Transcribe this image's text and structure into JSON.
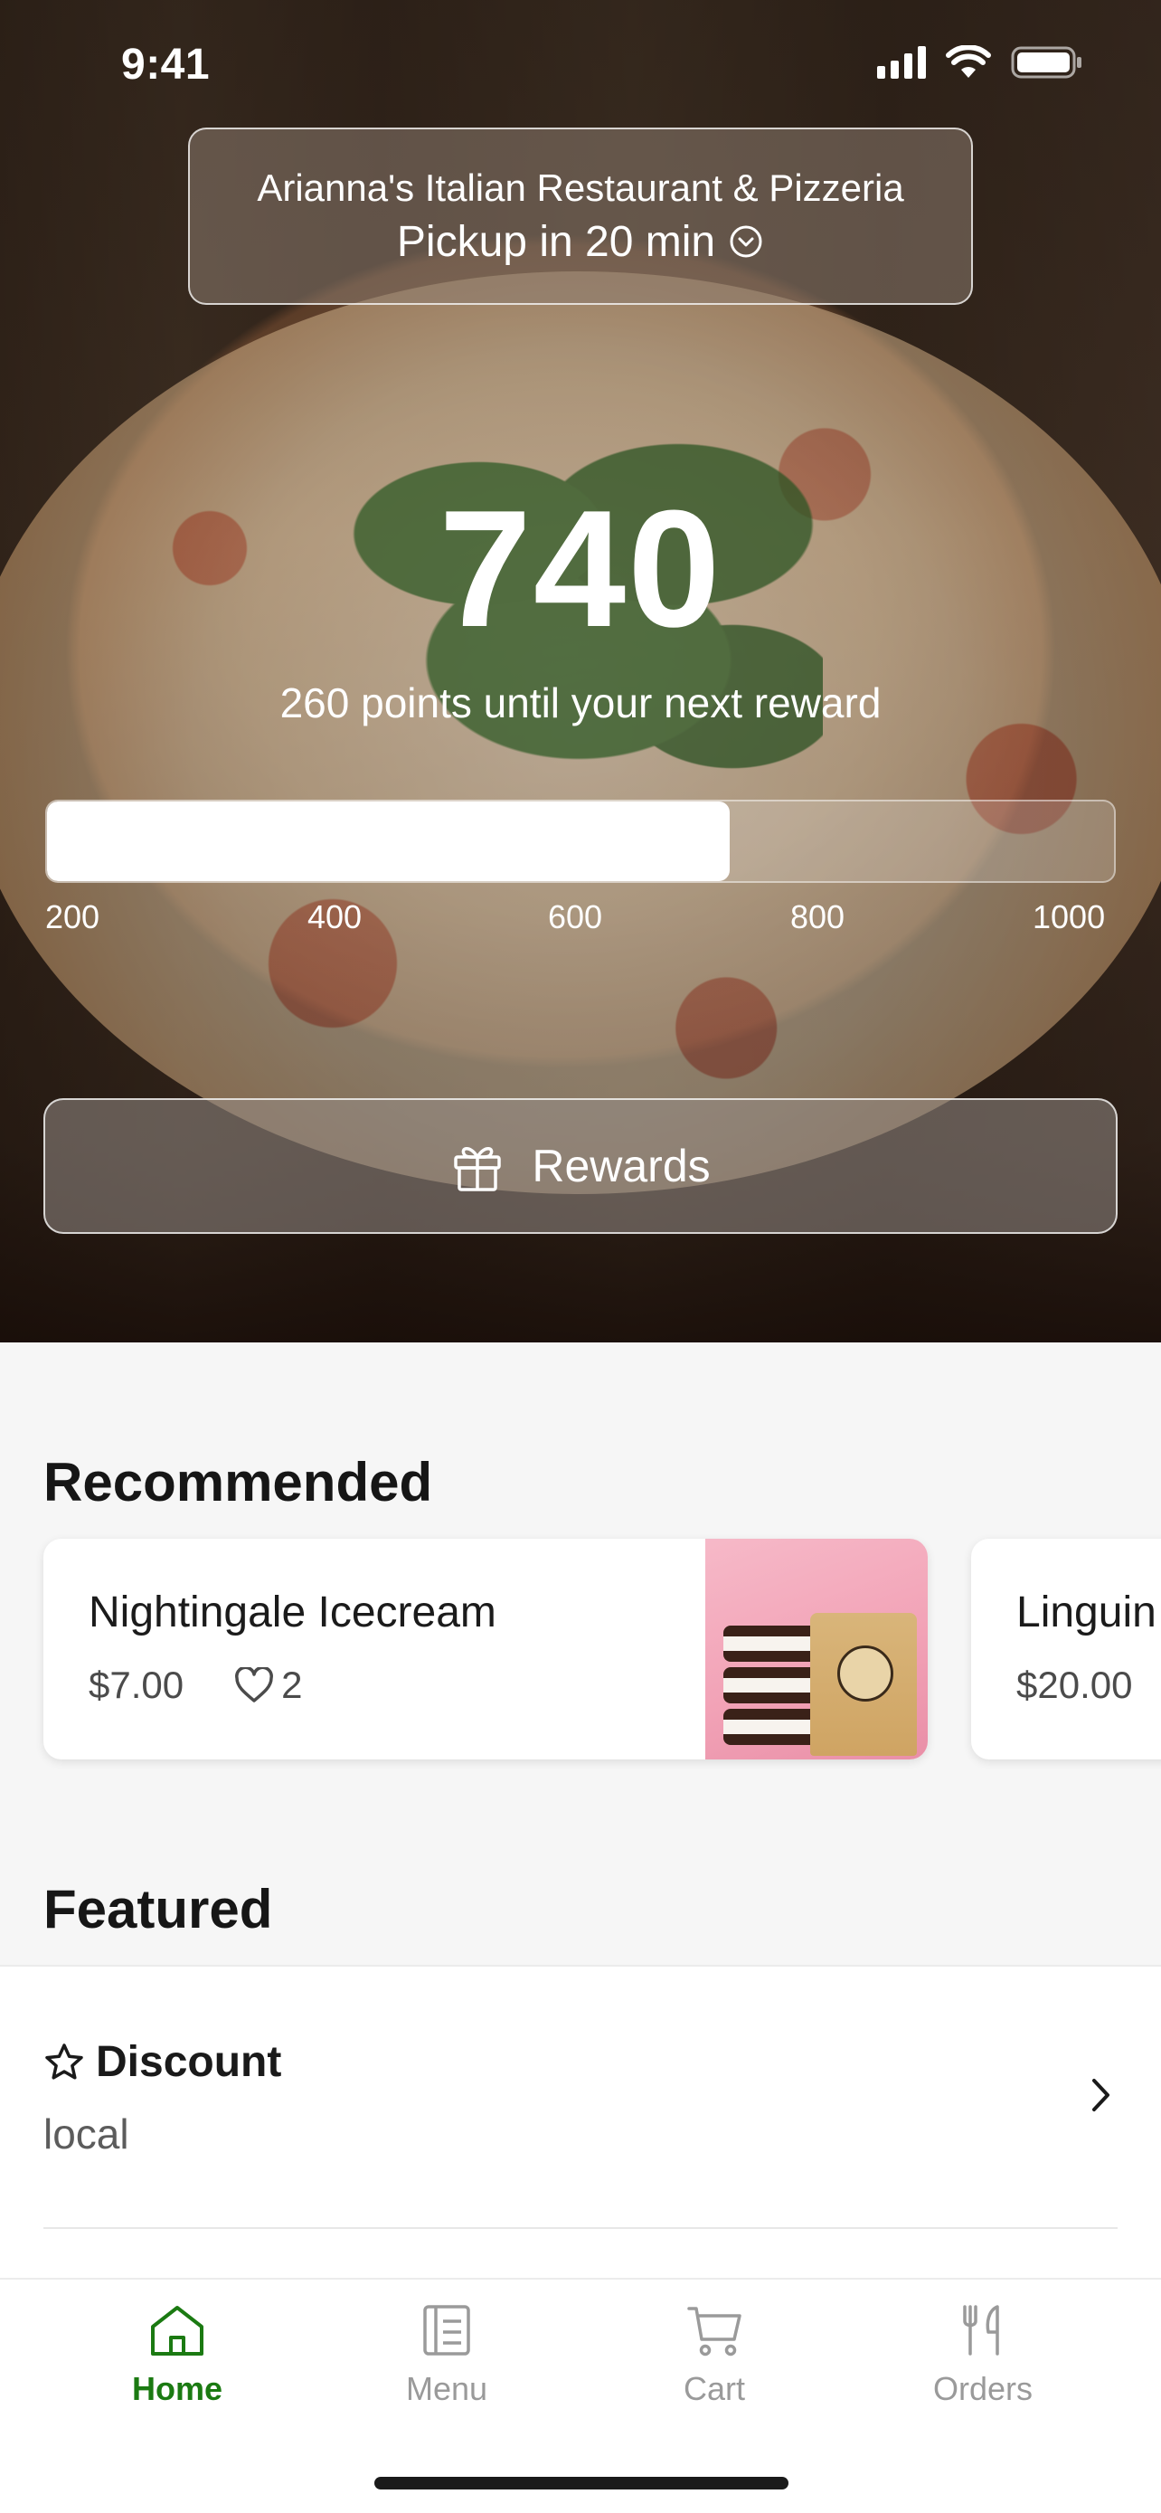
{
  "status_bar": {
    "time": "9:41"
  },
  "store": {
    "name": "Arianna's Italian Restaurant & Pizzeria",
    "pickup": "Pickup in 20 min"
  },
  "points": {
    "value": "740",
    "subtitle": "260 points until your next reward",
    "progress_fraction": 0.64,
    "ticks": [
      "200",
      "400",
      "600",
      "800",
      "1000"
    ]
  },
  "rewards": {
    "label": "Rewards"
  },
  "recommended": {
    "title": "Recommended",
    "items": [
      {
        "name": "Nightingale Icecream",
        "price": "$7.00",
        "likes": "2"
      },
      {
        "name": "Linguin",
        "price": "$20.00"
      }
    ]
  },
  "featured": {
    "title": "Featured",
    "items": [
      {
        "title": "Discount",
        "subtitle": "local"
      }
    ]
  },
  "tabs": [
    {
      "label": "Home",
      "icon": "home-icon",
      "active": true
    },
    {
      "label": "Menu",
      "icon": "menu-icon",
      "active": false
    },
    {
      "label": "Cart",
      "icon": "cart-icon",
      "active": false
    },
    {
      "label": "Orders",
      "icon": "orders-icon",
      "active": false
    }
  ],
  "colors": {
    "accent": "#1b7a12",
    "inactive": "#9a9a9a"
  }
}
